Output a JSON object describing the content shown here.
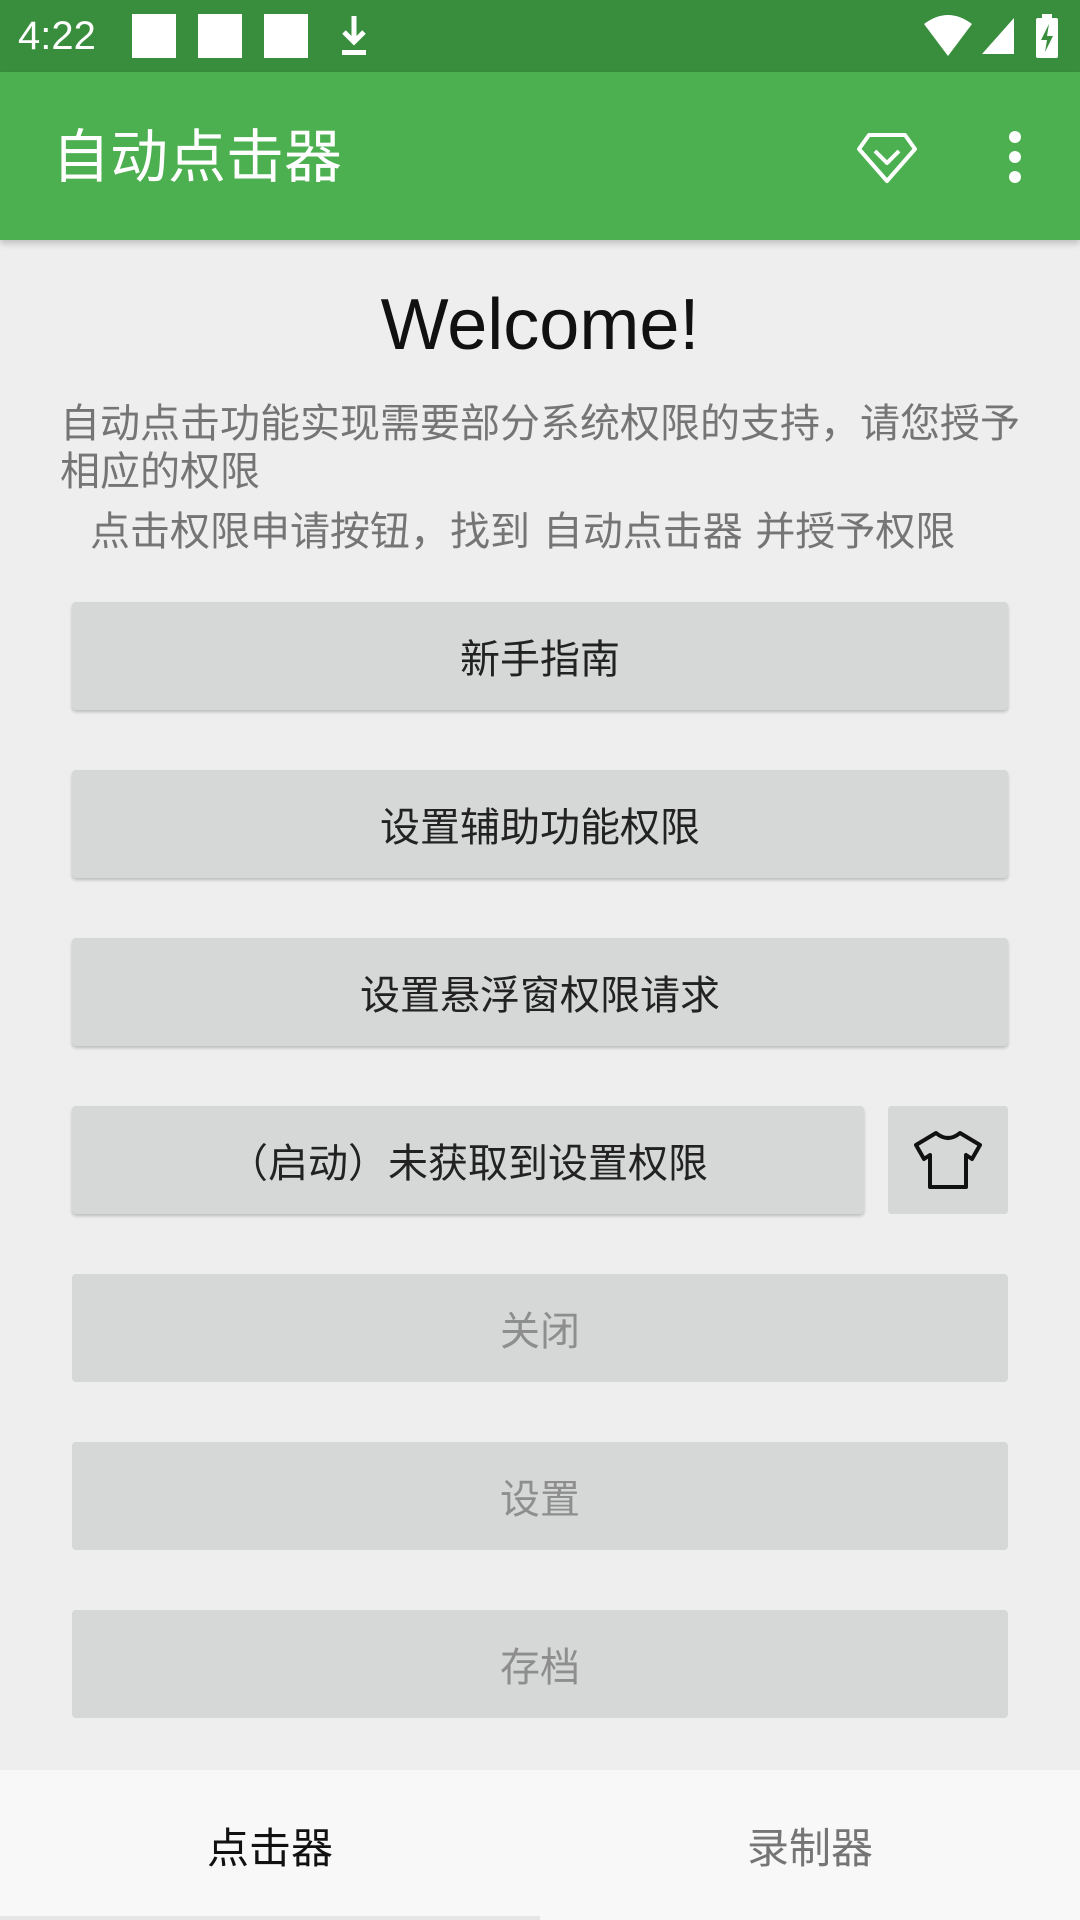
{
  "status_bar": {
    "time": "4:22",
    "icons": [
      "notification-square-icon",
      "notification-square-icon",
      "notification-square-icon",
      "download-icon",
      "wifi-icon",
      "cellular-signal-icon",
      "battery-charging-icon"
    ]
  },
  "app_bar": {
    "title": "自动点击器",
    "actions": [
      "diamond-icon",
      "more-vert-icon"
    ],
    "color": "#4caf50",
    "status_color": "#388e3c"
  },
  "main": {
    "welcome": "Welcome!",
    "description": "自动点击功能实现需要部分系统权限的支持，请您授予相应的权限",
    "instruction": "点击权限申请按钮，找到 自动点击器 并授予权限",
    "buttons": [
      {
        "label": "新手指南",
        "enabled": true
      },
      {
        "label": "设置辅助功能权限",
        "enabled": true
      },
      {
        "label": "设置悬浮窗权限请求",
        "enabled": true
      },
      {
        "label": "（启动）未获取到设置权限",
        "enabled": true
      },
      {
        "label": "关闭",
        "enabled": false
      },
      {
        "label": "设置",
        "enabled": false
      },
      {
        "label": "存档",
        "enabled": false
      }
    ],
    "skin_button_icon": "tshirt-icon"
  },
  "bottom_nav": {
    "tabs": [
      {
        "label": "点击器",
        "active": true
      },
      {
        "label": "录制器",
        "active": false
      }
    ]
  }
}
